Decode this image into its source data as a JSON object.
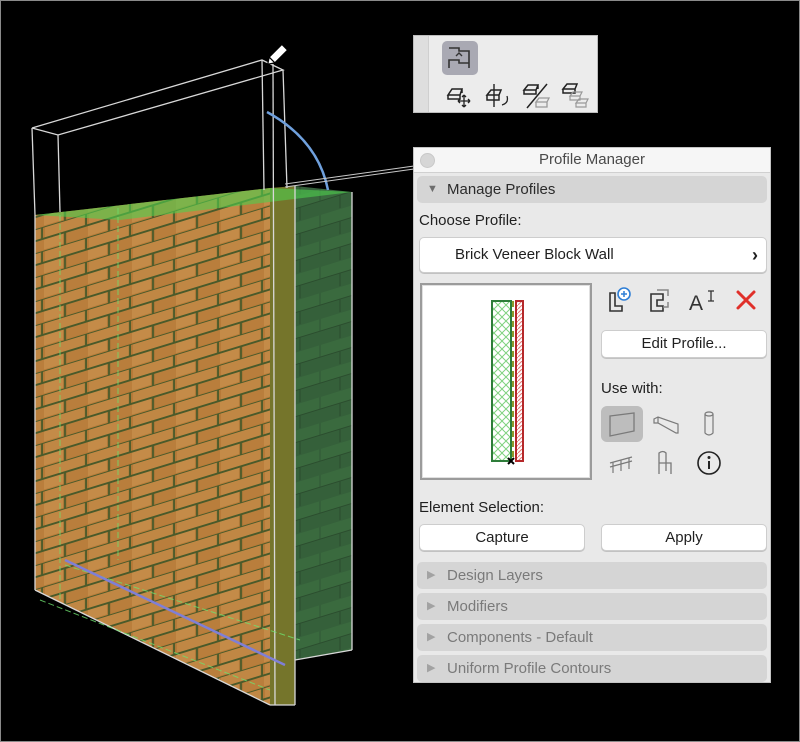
{
  "toolbar": {
    "buttons": [
      {
        "name": "profile-editor-icon",
        "active": true
      },
      {
        "name": "move-element-icon",
        "active": false
      },
      {
        "name": "rotate-element-icon",
        "active": false
      },
      {
        "name": "mirror-element-icon",
        "active": false
      },
      {
        "name": "multiply-element-icon",
        "active": false
      }
    ]
  },
  "panel": {
    "title": "Profile Manager",
    "manage_profiles": {
      "header": "Manage Profiles",
      "choose_profile_label": "Choose Profile:",
      "selected_profile": "Brick Veneer Block Wall",
      "chevron": "›",
      "actions": {
        "new_profile": "new-profile-icon",
        "duplicate_profile": "duplicate-profile-icon",
        "rename_profile": "rename-profile-icon",
        "delete_profile": "delete-icon"
      },
      "edit_profile_label": "Edit Profile...",
      "use_with_label": "Use with:",
      "use_with": [
        "Wall",
        "Beam",
        "Column",
        "Railing",
        "Object",
        "Info"
      ],
      "use_with_selected": "Wall",
      "element_selection_label": "Element Selection:",
      "capture_label": "Capture",
      "apply_label": "Apply"
    },
    "collapsed_sections": [
      "Design Layers",
      "Modifiers",
      "Components - Default",
      "Uniform Profile Contours"
    ],
    "colors": {
      "accent_blue": "#2f7fd6",
      "delete_red": "#e0302a",
      "profile_green": "#2e7d3a",
      "profile_red": "#b5282a"
    }
  },
  "viewport": {
    "element": "Brick veneer block wall (3D view)",
    "brick_color": "#b77a3a",
    "block_color": "#3d6b3d"
  }
}
